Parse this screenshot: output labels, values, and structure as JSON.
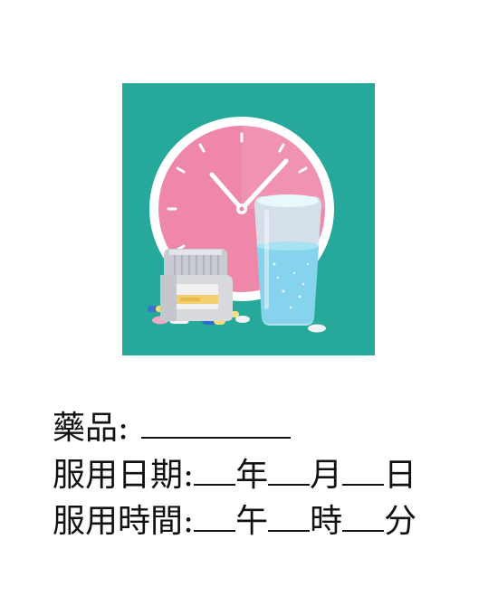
{
  "form": {
    "medicine_label": "藥品:",
    "date_label": "服用日期:",
    "date_year_unit": "年",
    "date_month_unit": "月",
    "date_day_unit": "日",
    "time_label": "服用時間:",
    "time_period_unit": "午",
    "time_hour_unit": "時",
    "time_minute_unit": "分"
  },
  "illustration": {
    "icons": [
      "clock-icon",
      "pill-bottle-icon",
      "water-glass-icon",
      "pills-icon"
    ],
    "colors": {
      "background": "#26a89b",
      "clock_face": "#ef8fac",
      "clock_rim": "#ffffff",
      "glass_water": "#8fd6ee",
      "bottle_body": "#d7d8dc",
      "bottle_label": "#f2d27a"
    }
  }
}
